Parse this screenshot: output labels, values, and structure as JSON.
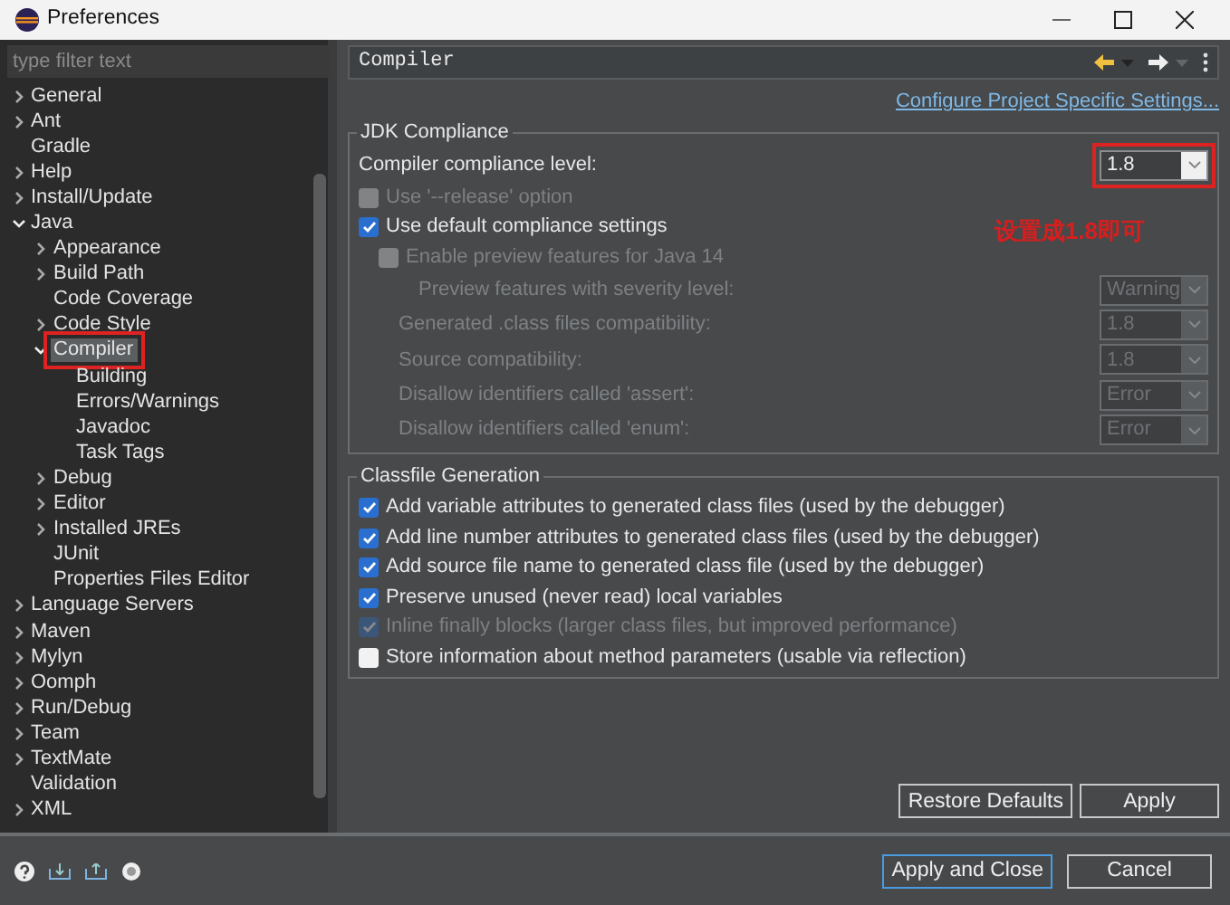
{
  "window": {
    "title": "Preferences"
  },
  "filter": {
    "placeholder": "type filter text"
  },
  "tree": [
    {
      "label": "General",
      "expanded": false,
      "selected": false
    },
    {
      "label": "Ant",
      "expanded": false,
      "selected": false
    },
    {
      "label": "Gradle",
      "selected": false
    },
    {
      "label": "Help",
      "expanded": false,
      "selected": false
    },
    {
      "label": "Install/Update",
      "expanded": false,
      "selected": false
    },
    {
      "label": "Java",
      "expanded": true,
      "selected": false,
      "children": [
        {
          "label": "Appearance",
          "expanded": false,
          "selected": false
        },
        {
          "label": "Build Path",
          "expanded": false,
          "selected": false
        },
        {
          "label": "Code Coverage",
          "selected": false
        },
        {
          "label": "Code Style",
          "expanded": false,
          "selected": false
        },
        {
          "label": "Compiler",
          "expanded": true,
          "selected": true,
          "annotated": true,
          "children": [
            {
              "label": "Building",
              "selected": false
            },
            {
              "label": "Errors/Warnings",
              "selected": false
            },
            {
              "label": "Javadoc",
              "selected": false
            },
            {
              "label": "Task Tags",
              "selected": false
            }
          ]
        },
        {
          "label": "Debug",
          "expanded": false,
          "selected": false
        },
        {
          "label": "Editor",
          "expanded": false,
          "selected": false
        },
        {
          "label": "Installed JREs",
          "expanded": false,
          "selected": false
        },
        {
          "label": "JUnit",
          "selected": false
        },
        {
          "label": "Properties Files Editor",
          "selected": false
        }
      ]
    },
    {
      "label": "Language Servers",
      "expanded": false,
      "selected": false
    },
    {
      "label": "Maven",
      "expanded": false,
      "selected": false
    },
    {
      "label": "Mylyn",
      "expanded": false,
      "selected": false
    },
    {
      "label": "Oomph",
      "expanded": false,
      "selected": false
    },
    {
      "label": "Run/Debug",
      "expanded": false,
      "selected": false
    },
    {
      "label": "Team",
      "expanded": false,
      "selected": false
    },
    {
      "label": "TextMate",
      "expanded": false,
      "selected": false
    },
    {
      "label": "Validation",
      "selected": false
    },
    {
      "label": "XML",
      "expanded": false,
      "selected": false
    }
  ],
  "page": {
    "title": "Compiler",
    "link": "Configure Project Specific Settings...",
    "groups": [
      {
        "title": "JDK Compliance",
        "rows": [
          {
            "kind": "select",
            "label": "Compiler compliance level:",
            "value": "1.8",
            "disabled": false,
            "annotated": true
          },
          {
            "kind": "checkbox",
            "label": "Use '--release' option",
            "checked": false,
            "disabled": true
          },
          {
            "kind": "checkbox",
            "label": "Use default compliance settings",
            "checked": true,
            "disabled": false,
            "children": [
              {
                "kind": "checkbox",
                "label": "Enable preview features for Java 14",
                "checked": false,
                "disabled": true,
                "children": [
                  {
                    "kind": "select",
                    "label": "Preview features with severity level:",
                    "value": "Warning",
                    "disabled": true
                  }
                ]
              },
              {
                "kind": "select",
                "label": "Generated .class files compatibility:",
                "value": "1.8",
                "disabled": true
              },
              {
                "kind": "select",
                "label": "Source compatibility:",
                "value": "1.8",
                "disabled": true
              },
              {
                "kind": "select",
                "label": "Disallow identifiers called 'assert':",
                "value": "Error",
                "disabled": true
              },
              {
                "kind": "select",
                "label": "Disallow identifiers called 'enum':",
                "value": "Error",
                "disabled": true
              }
            ]
          }
        ]
      },
      {
        "title": "Classfile Generation",
        "rows": [
          {
            "kind": "checkbox",
            "label": "Add variable attributes to generated class files (used by the debugger)",
            "checked": true,
            "disabled": false
          },
          {
            "kind": "checkbox",
            "label": "Add line number attributes to generated class files (used by the debugger)",
            "checked": true,
            "disabled": false
          },
          {
            "kind": "checkbox",
            "label": "Add source file name to generated class file (used by the debugger)",
            "checked": true,
            "disabled": false
          },
          {
            "kind": "checkbox",
            "label": "Preserve unused (never read) local variables",
            "checked": true,
            "disabled": false
          },
          {
            "kind": "checkbox",
            "label": "Inline finally blocks (larger class files, but improved performance)",
            "checked": true,
            "disabled": true
          },
          {
            "kind": "checkbox",
            "label": "Store information about method parameters (usable via reflection)",
            "checked": false,
            "disabled": false
          }
        ]
      }
    ],
    "buttons": [
      "Restore Defaults",
      "Apply"
    ]
  },
  "annotation": {
    "text": "设置成1.8即可"
  },
  "dialog_buttons": [
    {
      "label": "Apply and Close",
      "default": true
    },
    {
      "label": "Cancel",
      "default": false
    }
  ]
}
